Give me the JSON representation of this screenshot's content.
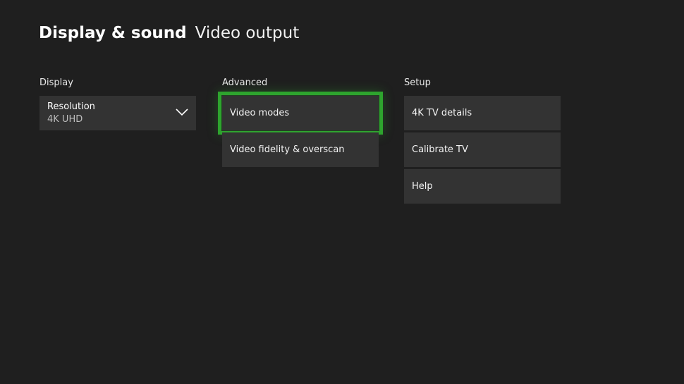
{
  "header": {
    "title": "Display & sound",
    "subtitle": "Video output"
  },
  "display": {
    "title": "Display",
    "resolution": {
      "label": "Resolution",
      "value": "4K UHD",
      "icon": "chevron-down-icon"
    }
  },
  "advanced": {
    "title": "Advanced",
    "items": [
      {
        "label": "Video modes",
        "focused": true
      },
      {
        "label": "Video fidelity & overscan",
        "focused": false
      }
    ]
  },
  "setup": {
    "title": "Setup",
    "items": [
      {
        "label": "4K TV details"
      },
      {
        "label": "Calibrate TV"
      },
      {
        "label": "Help"
      }
    ]
  },
  "colors": {
    "background": "#1f1f1f",
    "tile": "#333333",
    "focus": "#2ea42e"
  }
}
